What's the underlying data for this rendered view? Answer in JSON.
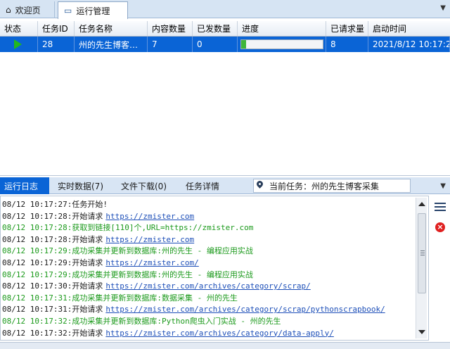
{
  "tabs": [
    {
      "label": "欢迎页",
      "icon": "home-icon"
    },
    {
      "label": "运行管理",
      "icon": "monitor-icon"
    }
  ],
  "grid": {
    "columns": [
      "状态",
      "任务ID",
      "任务名称",
      "内容数量",
      "已发数量",
      "进度",
      "已请求量",
      "启动时间"
    ],
    "rows": [
      {
        "status_icon": "play-icon",
        "task_id": "28",
        "task_name": "州的先生博客…",
        "content_count": "7",
        "sent_count": "0",
        "progress_fraction": 0.06,
        "requested": "8",
        "start_time": "2021/8/12 10:17:27"
      }
    ]
  },
  "panel": {
    "tabs": [
      "运行日志",
      "实时数据(7)",
      "文件下载(0)",
      "任务详情"
    ],
    "current_task_label": "当前任务：州的先生博客采集"
  },
  "log": [
    {
      "text": "08/12 10:17:27:任务开始!",
      "url": "",
      "color": "black"
    },
    {
      "text": "08/12 10:17:28:开始请求",
      "url": "https://zmister.com",
      "color": "black"
    },
    {
      "text": "08/12 10:17:28:获取到链接[110]个,URL=https://zmister.com",
      "url": "",
      "color": "green"
    },
    {
      "text": "08/12 10:17:28:开始请求",
      "url": "https://zmister.com",
      "color": "black"
    },
    {
      "text": "08/12 10:17:29:成功采集并更新到数据库:州的先生 - 编程应用实战",
      "url": "",
      "color": "green"
    },
    {
      "text": "08/12 10:17:29:开始请求",
      "url": "https://zmister.com/",
      "color": "black"
    },
    {
      "text": "08/12 10:17:29:成功采集并更新到数据库:州的先生 - 编程应用实战",
      "url": "",
      "color": "green"
    },
    {
      "text": "08/12 10:17:30:开始请求",
      "url": "https://zmister.com/archives/category/scrap/",
      "color": "black"
    },
    {
      "text": "08/12 10:17:31:成功采集并更新到数据库:数据采集 - 州的先生",
      "url": "",
      "color": "green"
    },
    {
      "text": "08/12 10:17:31:开始请求",
      "url": "https://zmister.com/archives/category/scrap/pythonscrapbook/",
      "color": "black"
    },
    {
      "text": "08/12 10:17:32:成功采集并更新到数据库:Python爬虫入门实战 - 州的先生",
      "url": "",
      "color": "green"
    },
    {
      "text": "08/12 10:17:32:开始请求",
      "url": "https://zmister.com/archives/category/data-apply/",
      "color": "black"
    }
  ],
  "colors": {
    "selection": "#0a64d6",
    "log_green": "#1c9a1c",
    "link_blue": "#1d4fb8",
    "progress_fill": "#3fb63a"
  }
}
